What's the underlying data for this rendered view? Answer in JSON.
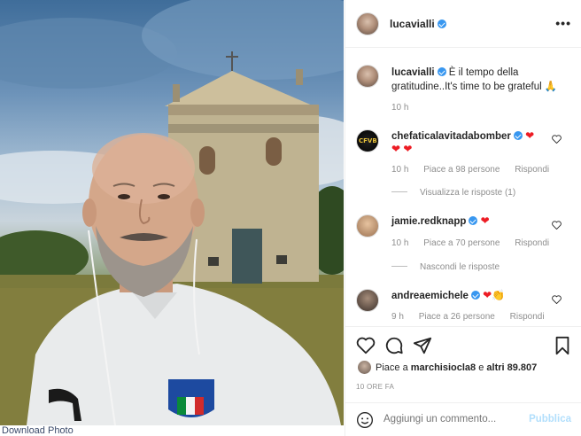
{
  "photo": {
    "alt": "",
    "download_label": "Download Photo"
  },
  "post": {
    "username": "lucavialli",
    "more_icon": "more-horizontal-icon",
    "caption_user": "lucavialli",
    "caption_line1": "È il tempo della",
    "caption_line2": "gratitudine..It's time to be grateful",
    "caption_emoji": "🙏",
    "caption_age": "10 h"
  },
  "comments": [
    {
      "user": "chefaticalavitadabomber",
      "text_emoji": "❤",
      "line2": "❤ ❤",
      "age": "10 h",
      "likes": "Piace a 98 persone",
      "reply": "Rispondi",
      "replies_link": "Visualizza le risposte (1)"
    },
    {
      "user": "jamie.redknapp",
      "text_emoji": "❤",
      "age": "10 h",
      "likes": "Piace a 70 persone",
      "reply": "Rispondi",
      "replies_link": "Nascondi le risposte"
    },
    {
      "user": "andreaemichele",
      "text_emoji": "❤👏",
      "age": "9 h",
      "likes": "Piace a 26 persone",
      "reply": "Rispondi"
    }
  ],
  "actions": {
    "like_icon": "heart-icon",
    "comment_icon": "comment-icon",
    "share_icon": "share-icon",
    "save_icon": "bookmark-icon",
    "likes_prefix": "Piace a",
    "likes_user": "marchisiocla8",
    "likes_middle": "e",
    "likes_others": "altri 89.807",
    "date": "10 ORE FA"
  },
  "comment_box": {
    "placeholder": "Aggiungi un commento...",
    "publish_label": "Pubblica",
    "emoji_icon": "smile-icon"
  },
  "colors": {
    "verified": "#3897f0",
    "publish_disabled": "#b2dffc",
    "muted_text": "#8e8e8e"
  }
}
